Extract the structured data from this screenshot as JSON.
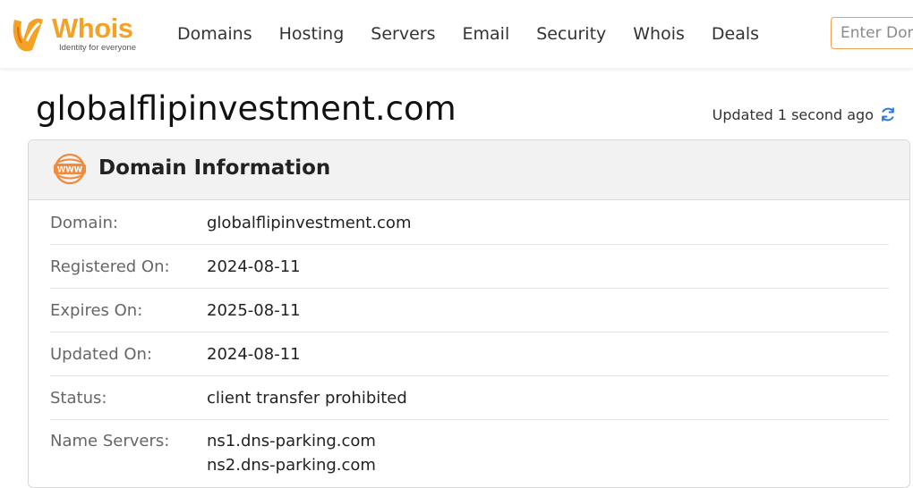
{
  "brand": {
    "name": "Whois",
    "tagline": "Identity for everyone",
    "color": "#f4a226"
  },
  "nav": {
    "items": [
      "Domains",
      "Hosting",
      "Servers",
      "Email",
      "Security",
      "Whois",
      "Deals"
    ]
  },
  "search": {
    "placeholder": "Enter Domain"
  },
  "page": {
    "title": "globalflipinvestment.com",
    "updated": "Updated 1 second ago"
  },
  "card": {
    "title": "Domain Information",
    "icon": "www-icon",
    "rows": [
      {
        "label": "Domain:",
        "value": "globalflipinvestment.com"
      },
      {
        "label": "Registered On:",
        "value": "2024-08-11"
      },
      {
        "label": "Expires On:",
        "value": "2025-08-11"
      },
      {
        "label": "Updated On:",
        "value": "2024-08-11"
      },
      {
        "label": "Status:",
        "value": "client transfer prohibited"
      },
      {
        "label": "Name Servers:",
        "values": [
          "ns1.dns-parking.com",
          "ns2.dns-parking.com"
        ]
      }
    ]
  },
  "colors": {
    "accent": "#f4a226",
    "refresh": "#2a7ae2",
    "card_header_bg": "#f2f2f2"
  }
}
